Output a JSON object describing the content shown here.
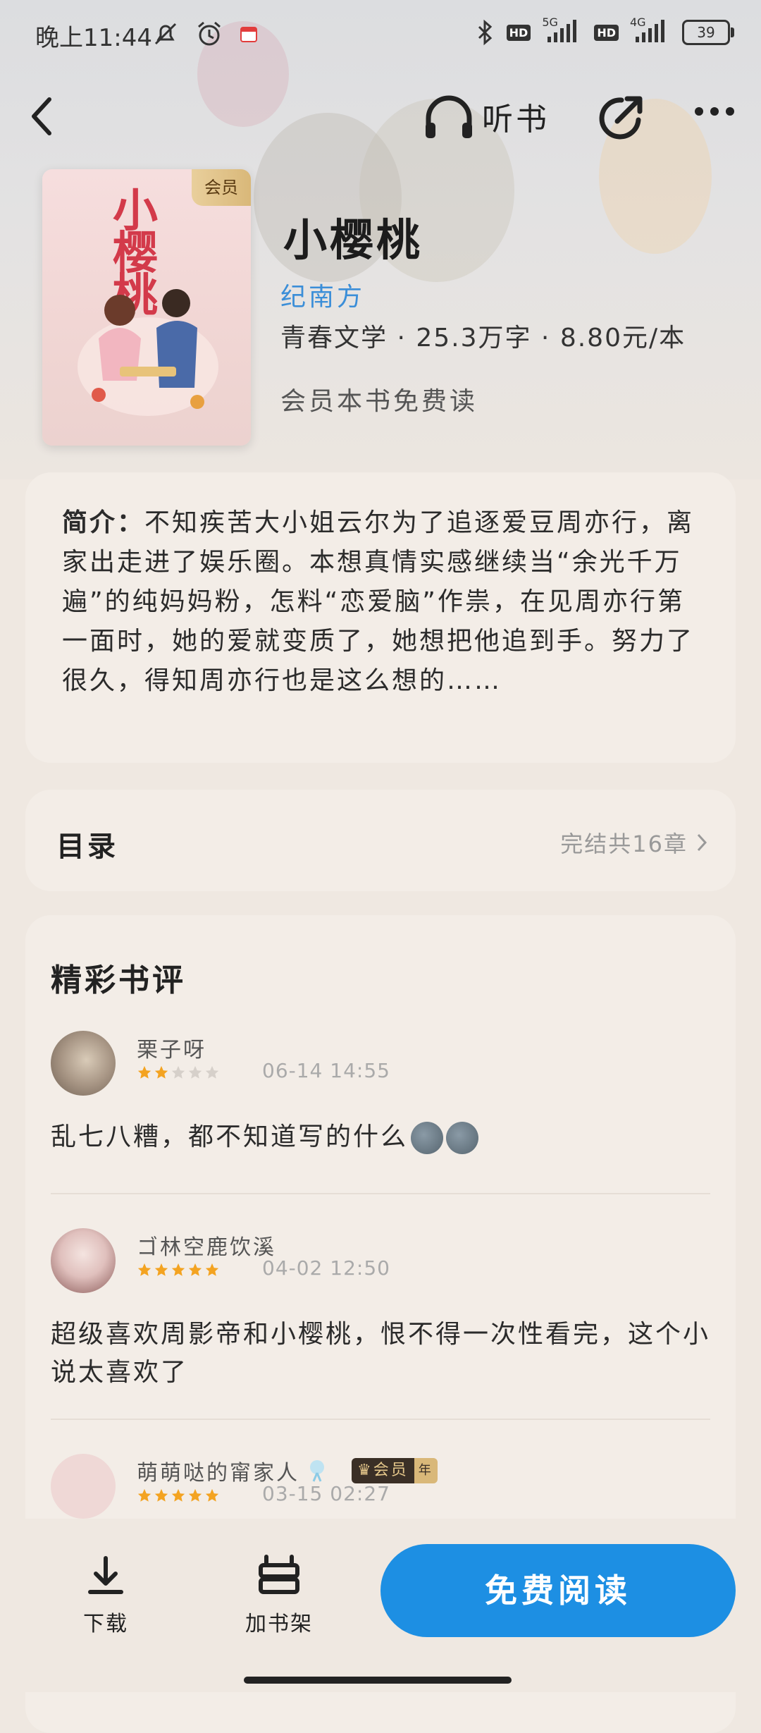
{
  "status_bar": {
    "time": "晚上11:44",
    "battery": "39",
    "net1": "5G",
    "net2": "4G",
    "hd": "HD"
  },
  "nav": {
    "listen_label": "听书"
  },
  "book": {
    "cover_badge": "会员",
    "cover_title": "小樱桃",
    "title": "小樱桃",
    "author": "纪南方",
    "meta": "青春文学 · 25.3万字 · 8.80元/本",
    "member_note": "会员本书免费读"
  },
  "intro": {
    "label": "简介：",
    "text": "不知疾苦大小姐云尔为了追逐爱豆周亦行，离家出走进了娱乐圈。本想真情实感继续当“余光千万遍”的纯妈妈粉，怎料“恋爱脑”作祟，在见周亦行第一面时，她的爱就变质了，她想把他追到手。努力了很久，得知周亦行也是这么想的……"
  },
  "toc": {
    "title": "目录",
    "status": "完结共16章"
  },
  "reviews": {
    "heading": "精彩书评",
    "items": [
      {
        "user": "栗子呀",
        "rating": 2,
        "date": "06-14  14:55",
        "text": "乱七八糟，都不知道写的什么"
      },
      {
        "user": "ゴ林空鹿饮溪",
        "rating": 5,
        "date": "04-02  12:50",
        "text": "超级喜欢周影帝和小樱桃，恨不得一次性看完，这个小说太喜欢了"
      },
      {
        "user": "萌萌哒的甯家人",
        "rating": 5,
        "date": "03-15  02:27",
        "badge": "会员",
        "badge_period": "年"
      }
    ]
  },
  "bottom": {
    "download_label": "下载",
    "shelf_label": "加书架",
    "read_label": "免费阅读"
  },
  "colors": {
    "accent": "#1d8fe3",
    "author": "#3b8ed8",
    "star": "#f3a321",
    "background": "#efe8e1"
  }
}
